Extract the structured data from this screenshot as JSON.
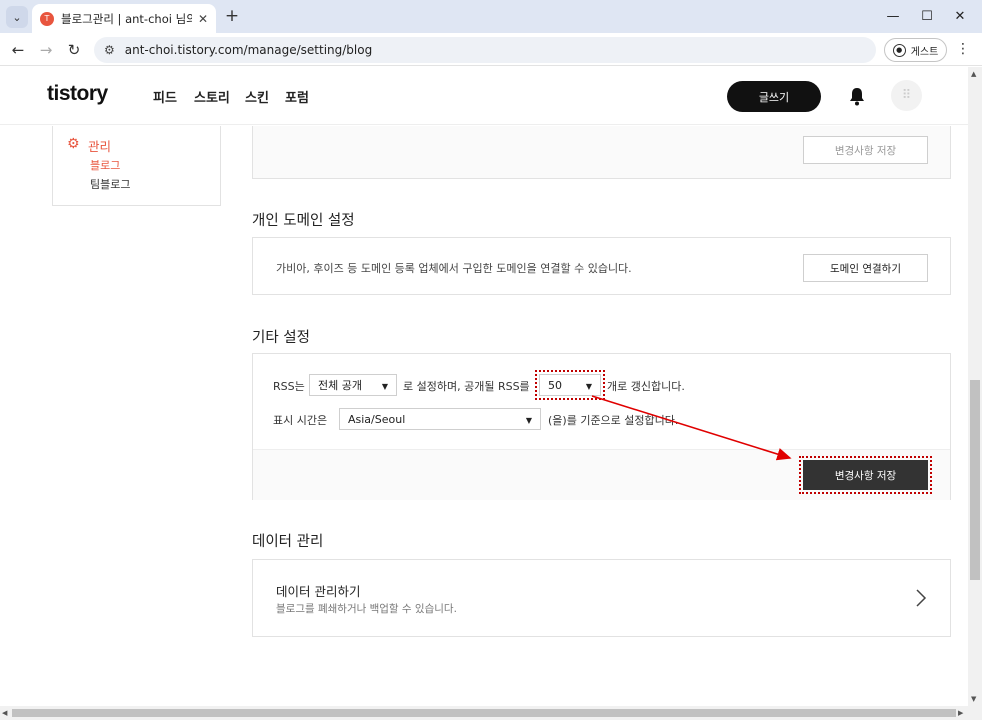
{
  "browser": {
    "tab_title": "블로그관리 | ant-choi 님의 블로",
    "favicon_letter": "T",
    "url": "ant-choi.tistory.com/manage/setting/blog",
    "guest_label": "게스트"
  },
  "header": {
    "logo": "tistory",
    "nav": [
      "피드",
      "스토리",
      "스킨",
      "포럼"
    ],
    "write_button": "글쓰기"
  },
  "sidebar": {
    "section_label": "관리",
    "items": [
      {
        "label": "블로그",
        "active": true
      },
      {
        "label": "팀블로그",
        "active": false
      }
    ]
  },
  "top_box": {
    "save_button": "변경사항 저장"
  },
  "domain_section": {
    "title": "개인 도메인 설정",
    "description": "가비아, 후이즈 등 도메인 등록 업체에서 구입한 도메인을 연결할 수 있습니다.",
    "button": "도메인 연결하기"
  },
  "etc_section": {
    "title": "기타 설정",
    "rss_prefix": "RSS는",
    "rss_visibility": "전체 공개",
    "rss_middle": "로 설정하며, 공개될 RSS를",
    "rss_count": "50",
    "rss_suffix": "개로 갱신합니다.",
    "time_prefix": "표시 시간은",
    "timezone": "Asia/Seoul",
    "time_suffix": "(을)를 기준으로 설정합니다.",
    "save_button": "변경사항 저장"
  },
  "data_section": {
    "title": "데이터 관리",
    "item_title": "데이터 관리하기",
    "item_description": "블로그를 폐쇄하거나 백업할 수 있습니다."
  },
  "colors": {
    "accent": "#e8553e",
    "annotation": "#e00000",
    "dark_button": "#333333"
  }
}
